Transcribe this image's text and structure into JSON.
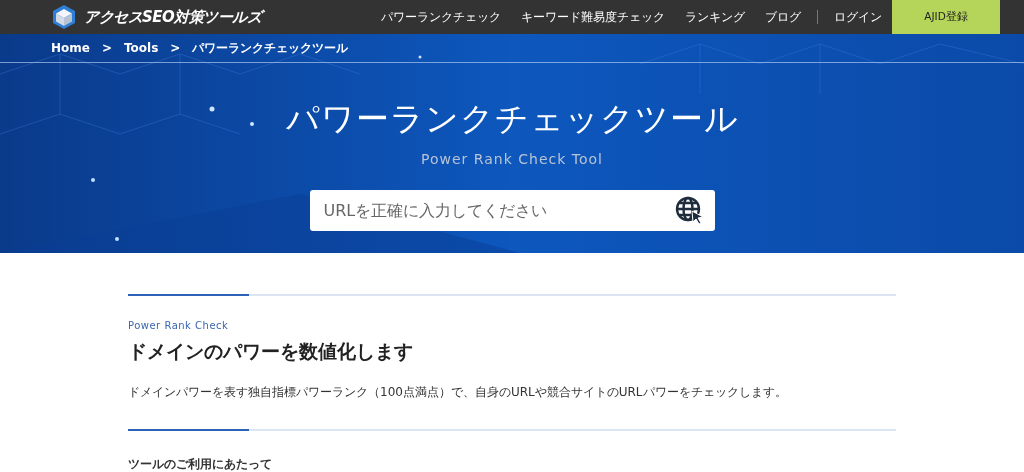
{
  "header": {
    "logo_text": "アクセスSEO対策ツールズ",
    "nav": [
      {
        "label": "パワーランクチェック",
        "kind": "link"
      },
      {
        "label": "キーワード難易度チェック",
        "kind": "link"
      },
      {
        "label": "ランキング",
        "kind": "link"
      },
      {
        "label": "ブログ",
        "kind": "link"
      },
      {
        "label": "ログイン",
        "kind": "link"
      },
      {
        "label": "AJID登録",
        "kind": "cta"
      }
    ]
  },
  "breadcrumb": [
    "Home",
    ">",
    "Tools",
    ">",
    "パワーランクチェックツール"
  ],
  "hero": {
    "title": "パワーランクチェックツール",
    "subtitle": "Power Rank Check Tool",
    "search": {
      "placeholder": "URLを正確に入力してください"
    }
  },
  "sections": [
    {
      "eyebrow": "Power Rank Check",
      "heading": "ドメインのパワーを数値化します",
      "text": "ドメインパワーを表す独自指標パワーランク（100点満点）で、自身のURLや競合サイトのURLパワーをチェックします。"
    },
    {
      "heading": "ツールのご利用にあたって"
    }
  ]
}
